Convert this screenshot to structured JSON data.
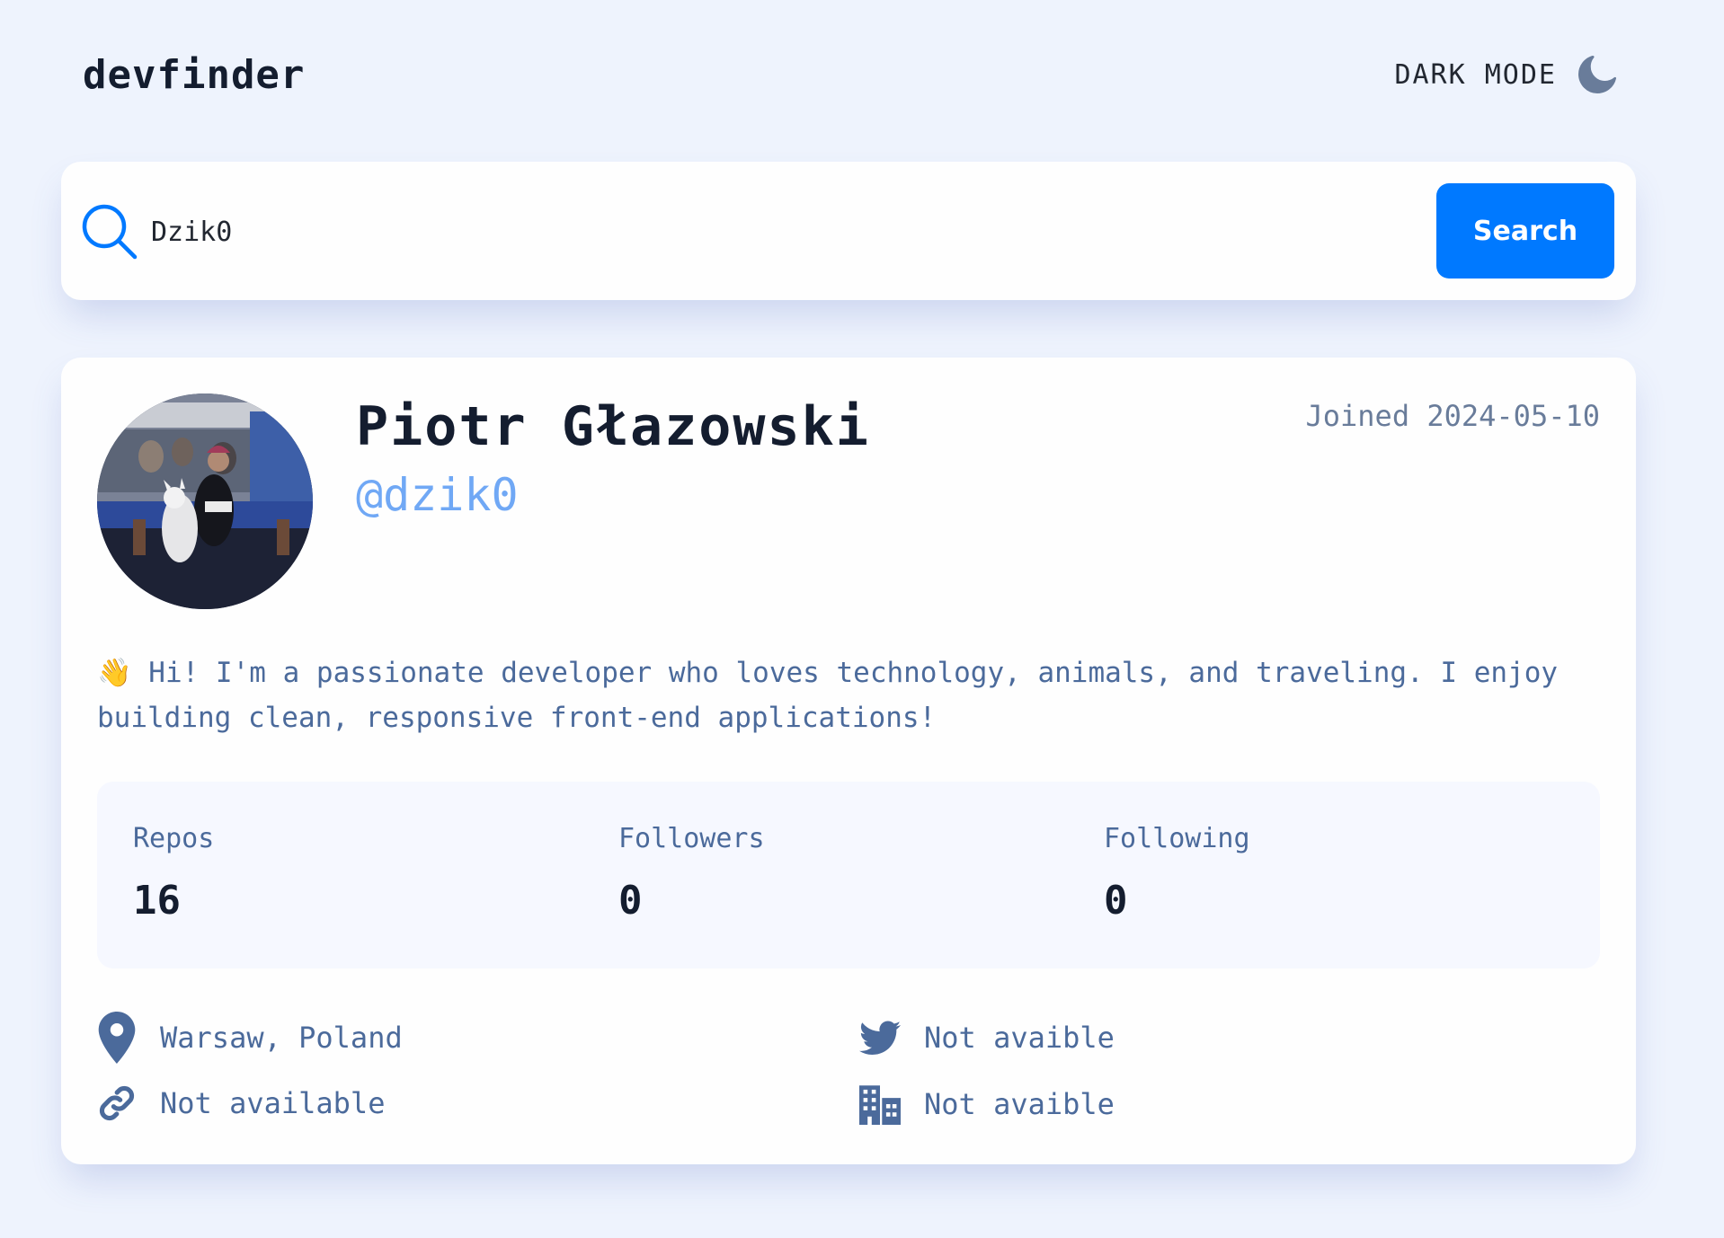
{
  "header": {
    "logo": "devfinder",
    "theme_toggle_label": "DARK MODE",
    "theme_icon": "moon-icon"
  },
  "search": {
    "icon": "search-icon",
    "value": "Dzik0",
    "placeholder": "",
    "button_label": "Search"
  },
  "profile": {
    "name": "Piotr Głazowski",
    "login": "@dzik0",
    "joined": "Joined 2024-05-10",
    "bio_emoji": "👋",
    "bio": "Hi! I'm a passionate developer who loves technology, animals, and traveling. I enjoy building clean, responsive front-end applications!",
    "stats": [
      {
        "label": "Repos",
        "value": "16"
      },
      {
        "label": "Followers",
        "value": "0"
      },
      {
        "label": "Following",
        "value": "0"
      }
    ],
    "links": {
      "location": {
        "icon": "location-pin-icon",
        "text": "Warsaw, Poland"
      },
      "twitter": {
        "icon": "twitter-icon",
        "text": "Not avaible"
      },
      "website": {
        "icon": "link-icon",
        "text": "Not available"
      },
      "company": {
        "icon": "building-icon",
        "text": "Not avaible"
      }
    }
  },
  "colors": {
    "background": "#eef3fd",
    "card": "#fefefe",
    "accent": "#0079ff",
    "login": "#70a8f5",
    "text_dark": "#141d2f",
    "text_muted": "#4b6a9b"
  }
}
